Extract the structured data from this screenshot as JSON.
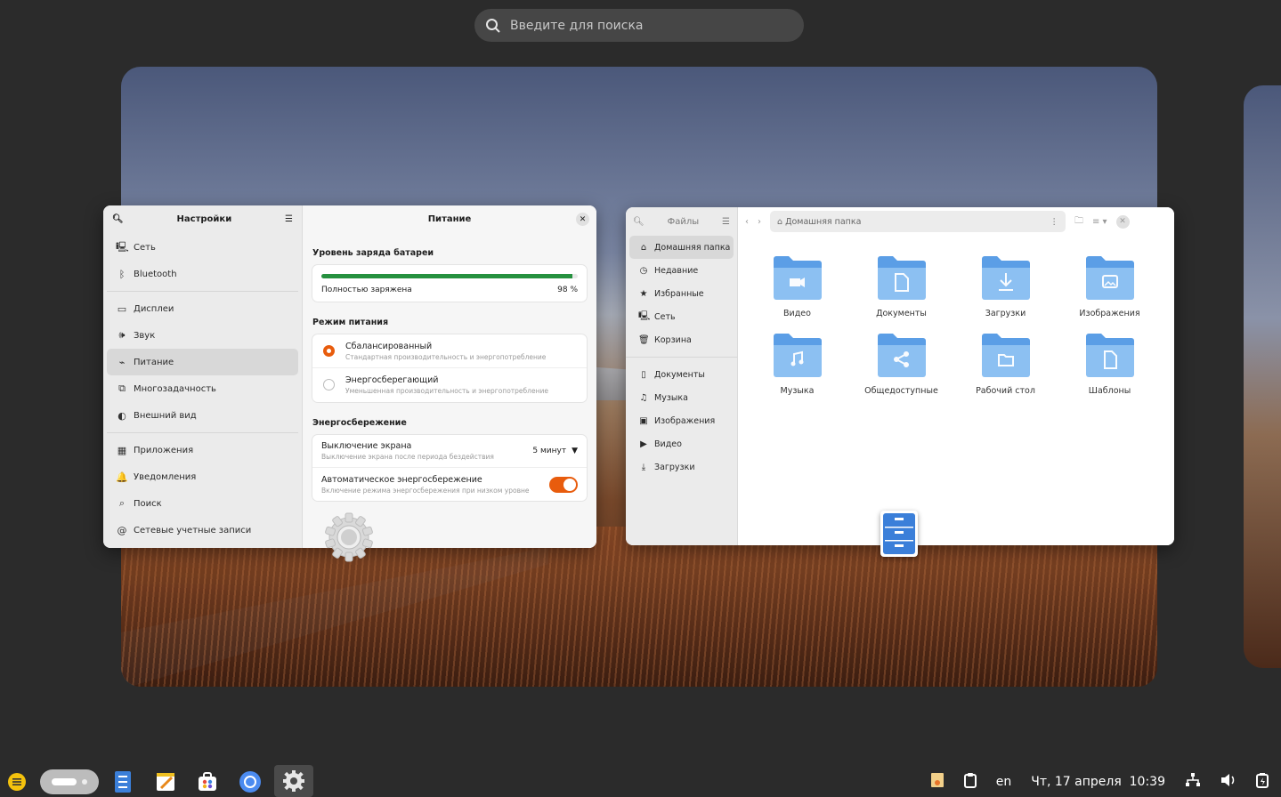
{
  "search": {
    "placeholder": "Введите для поиска"
  },
  "settings": {
    "title": "Настройки",
    "panel_title": "Питание",
    "sidebar": [
      {
        "label": "Сеть",
        "icon": "network-icon"
      },
      {
        "label": "Bluetooth",
        "icon": "bluetooth-icon"
      },
      {
        "label": "Дисплеи",
        "icon": "display-icon"
      },
      {
        "label": "Звук",
        "icon": "sound-icon"
      },
      {
        "label": "Питание",
        "icon": "power-icon",
        "active": true
      },
      {
        "label": "Многозадачность",
        "icon": "multitasking-icon"
      },
      {
        "label": "Внешний вид",
        "icon": "appearance-icon"
      },
      {
        "label": "Приложения",
        "icon": "apps-icon"
      },
      {
        "label": "Уведомления",
        "icon": "bell-icon"
      },
      {
        "label": "Поиск",
        "icon": "search-icon"
      },
      {
        "label": "Сетевые учетные записи",
        "icon": "online-accounts-icon"
      }
    ],
    "battery": {
      "heading": "Уровень заряда батареи",
      "status": "Полностью заряжена",
      "percent_text": "98 %",
      "level": 0.98,
      "bar_color": "#26913f"
    },
    "power_mode": {
      "heading": "Режим питания",
      "options": [
        {
          "title": "Сбалансированный",
          "desc": "Стандартная производительность и энергопотребление",
          "selected": true
        },
        {
          "title": "Энергосберегающий",
          "desc": "Уменьшенная производительность и энергопотребление",
          "selected": false
        }
      ]
    },
    "saving": {
      "heading": "Энергосбережение",
      "screen_off": {
        "title": "Выключение экрана",
        "desc": "Выключение экрана после периода бездействия",
        "value": "5 минут"
      },
      "auto": {
        "title": "Автоматическое энергосбережение",
        "desc": "Включение режима энергосбережения при низком уровне",
        "enabled": true
      }
    },
    "accent": "#e85c0d"
  },
  "files": {
    "title": "Файлы",
    "path": "Домашняя папка",
    "places": [
      {
        "label": "Домашняя папка",
        "icon": "home-icon",
        "active": true
      },
      {
        "label": "Недавние",
        "icon": "clock-icon"
      },
      {
        "label": "Избранные",
        "icon": "star-icon"
      },
      {
        "label": "Сеть",
        "icon": "network-icon"
      },
      {
        "label": "Корзина",
        "icon": "trash-icon"
      }
    ],
    "bookmarks": [
      {
        "label": "Документы",
        "icon": "document-icon"
      },
      {
        "label": "Музыка",
        "icon": "music-icon"
      },
      {
        "label": "Изображения",
        "icon": "image-icon"
      },
      {
        "label": "Видео",
        "icon": "video-icon"
      },
      {
        "label": "Загрузки",
        "icon": "download-icon"
      }
    ],
    "folders": [
      {
        "label": "Видео",
        "glyph": "video"
      },
      {
        "label": "Документы",
        "glyph": "doc"
      },
      {
        "label": "Загрузки",
        "glyph": "down"
      },
      {
        "label": "Изображения",
        "glyph": "img"
      },
      {
        "label": "Музыка",
        "glyph": "music"
      },
      {
        "label": "Общедоступные",
        "glyph": "share"
      },
      {
        "label": "Рабочий стол",
        "glyph": "desk"
      },
      {
        "label": "Шаблоны",
        "glyph": "tmpl"
      }
    ],
    "folder_color": "#5b9ee6"
  },
  "tray": {
    "lang": "en",
    "datetime": "Чт, 17 апреля  10:39"
  },
  "dock": {
    "apps": [
      "menu-icon",
      "workspace-switcher",
      "files-app-icon",
      "text-editor-icon",
      "app-store-icon",
      "chromium-icon",
      "settings-app-icon"
    ]
  }
}
